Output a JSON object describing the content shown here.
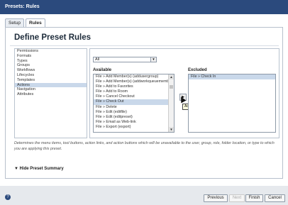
{
  "window": {
    "title": "Presets: Rules"
  },
  "tabs": [
    {
      "label": "Setup"
    },
    {
      "label": "Rules"
    }
  ],
  "page": {
    "heading": "Define Preset Rules"
  },
  "categories": [
    "Permissions",
    "Formats",
    "Types",
    "Groups",
    "Workflows",
    "Lifecycles",
    "Templates",
    "Actions",
    "Navigation",
    "Attributes"
  ],
  "filter": {
    "selected": "All"
  },
  "available": {
    "label": "Available",
    "items": [
      "File » Add Member(s) (addusergroup)",
      "File » Add Member(s) (addworkqueuemember)",
      "File » Add to Favorites",
      "File » Add to Room",
      "File » Cancel Checkout",
      "File » Check Out",
      "File » Delete",
      "File » Edit (editfile)",
      "File » Edit (editpreset)",
      "File » Email as Web-link",
      "File » Export (export)"
    ]
  },
  "excluded": {
    "label": "Excluded",
    "items": [
      "File » Check In"
    ]
  },
  "move": {
    "tooltip": "Add"
  },
  "description": "Determines the menu items, tool buttons, action links, and action buttons which will be unavailable to the user, group, role, folder location, or type to which you are applying this preset.",
  "summary_toggle": "Hide Preset Summary",
  "footer": {
    "help": "?",
    "previous": "Previous",
    "next": "Next",
    "finish": "Finish",
    "cancel": "Cancel"
  }
}
